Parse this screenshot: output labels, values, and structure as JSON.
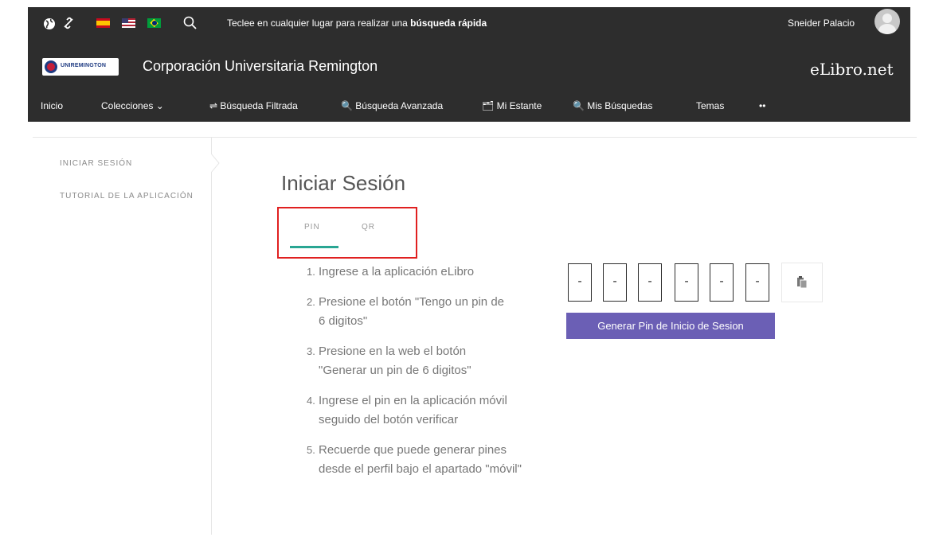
{
  "topbar": {
    "search_text_normal": "Teclee en cualquier lugar para realizar una ",
    "search_text_bold": "búsqueda rápida",
    "user_name": "Sneider Palacio",
    "icons": [
      "globe-icon",
      "link-icon",
      "flag-es-icon",
      "flag-us-icon",
      "flag-br-icon",
      "search-icon"
    ]
  },
  "header": {
    "logo_text": "UNIREMINGTON",
    "institution": "Corporación Universitaria Remington",
    "brand": "eLibro.net"
  },
  "nav": {
    "items": [
      {
        "label": "Inicio"
      },
      {
        "label": "Colecciones  ⌄"
      },
      {
        "label": "⇌ Búsqueda Filtrada"
      },
      {
        "label": "🔍 Búsqueda Avanzada"
      },
      {
        "label": "🗂 Mi Estante"
      },
      {
        "label": "🔍 Mis Búsquedas"
      },
      {
        "label": "Temas"
      },
      {
        "label": "••"
      }
    ]
  },
  "sidebar": {
    "items": [
      {
        "label": "INICIAR SESIÓN"
      },
      {
        "label": "TUTORIAL DE LA APLICACIÓN"
      }
    ]
  },
  "main": {
    "title": "Iniciar Sesión",
    "tabs": [
      {
        "label": "PIN",
        "active": true
      },
      {
        "label": "QR",
        "active": false
      }
    ],
    "steps": [
      {
        "num": "1.",
        "text": "Ingrese a la aplicación eLibro"
      },
      {
        "num": "2.",
        "text": "Presione el botón \"Tengo un pin de 6 digitos\""
      },
      {
        "num": "3.",
        "text": "Presione en la web el botón \"Generar un pin de 6 digitos\""
      },
      {
        "num": "4.",
        "text": "Ingrese el pin en la aplicación móvil seguido del botón verificar"
      },
      {
        "num": "5.",
        "text": "Recuerde que puede generar pines desde el perfil bajo el apartado \"móvil\""
      }
    ],
    "pin_digits": [
      "-",
      "-",
      "-",
      "-",
      "-",
      "-"
    ],
    "generate_button": "Generar Pin de Inicio de Sesion"
  },
  "colors": {
    "topbar": "#2d2d2d",
    "accent_tab": "#29a693",
    "button": "#6b5fb5",
    "highlight": "#e02020"
  }
}
